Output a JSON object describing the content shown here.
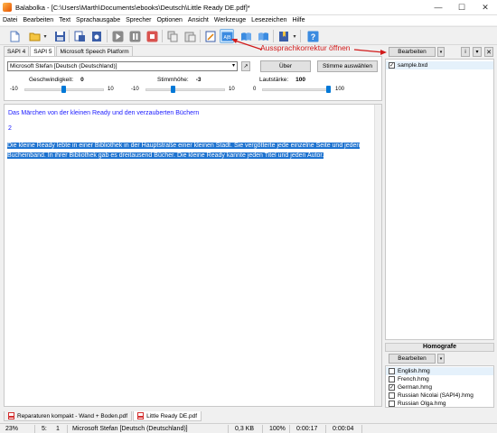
{
  "window": {
    "title": "Balabolka - [C:\\Users\\Marth\\Documents\\ebooks\\Deutsch\\Little Ready DE.pdf]*"
  },
  "menu": [
    "Datei",
    "Bearbeiten",
    "Text",
    "Sprachausgabe",
    "Sprecher",
    "Optionen",
    "Ansicht",
    "Werkzeuge",
    "Lesezeichen",
    "Hilfe"
  ],
  "toolbar_icons": [
    "new-file-icon",
    "open-folder-icon",
    "save-icon",
    "convert-icon",
    "save-audio-icon",
    "play-icon",
    "pause-icon",
    "stop-icon",
    "copy-icon",
    "paste-icon",
    "edit-dictionary-icon",
    "pronunciation-correction-icon",
    "book-open-icon",
    "book-icon",
    "bookmark-icon",
    "help-icon"
  ],
  "annotation": {
    "text": "Aussprachkorrektur öffnen",
    "color": "#d11a1a"
  },
  "right_panel": {
    "edit_button": "Bearbeiten",
    "files": [
      {
        "name": "sample.bxd",
        "checked": true
      }
    ]
  },
  "voice_tabs": [
    "SAPI 4",
    "SAPI 5",
    "Microsoft Speech Platform"
  ],
  "voice": {
    "selected": "Microsoft Stefan [Deutsch (Deutschland)]",
    "about_button": "Über",
    "choose_voice_button": "Stimme auswählen",
    "speed": {
      "label": "Geschwindigkeit:",
      "value": "0",
      "min": "-10",
      "max": "10"
    },
    "pitch": {
      "label": "Stimmhöhe:",
      "value": "-3",
      "min": "-10",
      "max": "10"
    },
    "volume": {
      "label": "Lautstärke:",
      "value": "100",
      "min": "0",
      "max": "100"
    }
  },
  "editor": {
    "title_line": "Das Märchen von der kleinen Ready und den verzauberten Büchern",
    "number_line": "2",
    "selected_text_1": "Die kleine Ready lebte in einer Bibliothek in der Hauptstraße einer kleinen Stadt. Sie vergötterte jede einzelne Seite und jeden",
    "selected_text_2": "Bucheinband. In ihrer Bibliothek gab es dreitausend Bücher. Die kleine Ready kannte jeden Titel und jeden Autor."
  },
  "homografe": {
    "header": "Homografe",
    "edit_button": "Bearbeiten",
    "items": [
      {
        "name": "English.hmg",
        "checked": false
      },
      {
        "name": "French.hmg",
        "checked": false
      },
      {
        "name": "German.hmg",
        "checked": true
      },
      {
        "name": "Russian Nicolai (SAPI4).hmg",
        "checked": false
      },
      {
        "name": "Russian Olga.hmg",
        "checked": false
      }
    ]
  },
  "document_tabs": [
    "Reparaturen kompakt - Wand + Boden.pdf",
    "Little Ready DE.pdf"
  ],
  "status": {
    "percent": "23%",
    "line": "5:",
    "col": "1",
    "voice": "Microsoft Stefan [Deutsch (Deutschland)]",
    "size": "0,3 KB",
    "zoom": "100%",
    "time_elapsed": "0:00:17",
    "time_total": "0:00:04"
  }
}
